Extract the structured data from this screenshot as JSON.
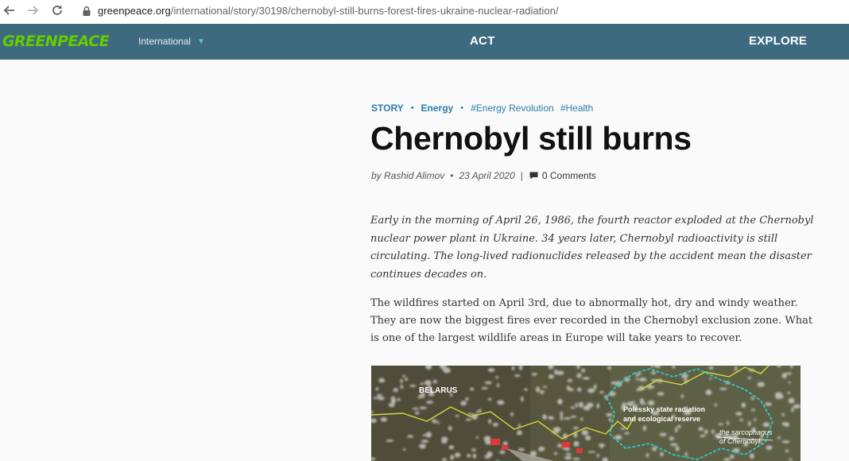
{
  "browser": {
    "url_domain": "greenpeace.org",
    "url_path": "/international/story/30198/chernobyl-still-burns-forest-fires-ukraine-nuclear-radiation/"
  },
  "header": {
    "logo": "GREENPEACE",
    "region": "International",
    "nav_act": "ACT",
    "nav_explore": "EXPLORE"
  },
  "article": {
    "tags": {
      "story": "STORY",
      "energy": "Energy",
      "energy_revolution": "#Energy Revolution",
      "health": "#Health"
    },
    "title": "Chernobyl still burns",
    "byline": {
      "author": "by Rashid Alimov",
      "date": "23 April 2020",
      "comments": "0 Comments"
    },
    "lead_lines": [
      "Early in the morning of April 26, 1986, the fourth reactor exploded at the Chernobyl",
      "nuclear power plant in Ukraine. 34 years later, Chernobyl radioactivity is still",
      "circulating. The long-lived radionuclides released by the accident mean the disaster",
      "continues decades on."
    ],
    "body_lines": [
      "The wildfires started on April 3rd, due to abnormally hot, dry and windy weather.",
      "They are now the biggest fires ever recorded in the Chernobyl exclusion zone. What",
      "is one of the largest wildlife areas in Europe will take years to recover."
    ],
    "map": {
      "label_belarus": "BELARUS",
      "label_reserve_1": "Polessky state radiation",
      "label_reserve_2": "and ecological reserve",
      "label_sarc_1": "the sarcophagus",
      "label_sarc_2": "of Chernobyl"
    }
  },
  "colors": {
    "header_bg": "#3e6a80",
    "logo_green": "#66cc00",
    "tag_blue": "#2a7cad",
    "caret_cyan": "#5fc4dc"
  }
}
